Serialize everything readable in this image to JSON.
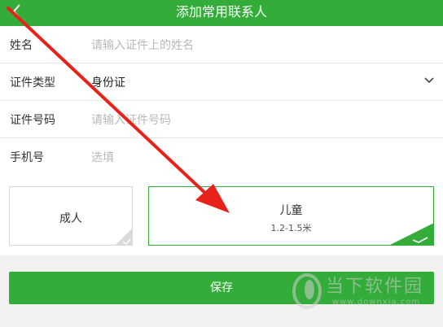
{
  "header": {
    "title": "添加常用联系人",
    "back_icon": "back-chevron-icon",
    "background": "#33ac3a"
  },
  "form": {
    "fields": [
      {
        "label": "姓名",
        "placeholder": "请输入证件上的姓名"
      },
      {
        "label": "证件类型",
        "value": "身份证",
        "icon": "chevron-down-icon"
      },
      {
        "label": "证件号码",
        "placeholder": "请输入证件号码"
      },
      {
        "label": "手机号",
        "placeholder": "选填"
      }
    ]
  },
  "passenger_type": {
    "options": [
      {
        "name": "成人",
        "selected": false
      },
      {
        "name": "儿童",
        "sub": "1.2-1.5米",
        "selected": true
      }
    ]
  },
  "save_button": {
    "label": "保存"
  },
  "watermark": {
    "text": "当下软件园",
    "url": "www.downxia.com"
  },
  "colors": {
    "accent": "#33ac3a",
    "annotation_arrow": "#e8221b"
  }
}
